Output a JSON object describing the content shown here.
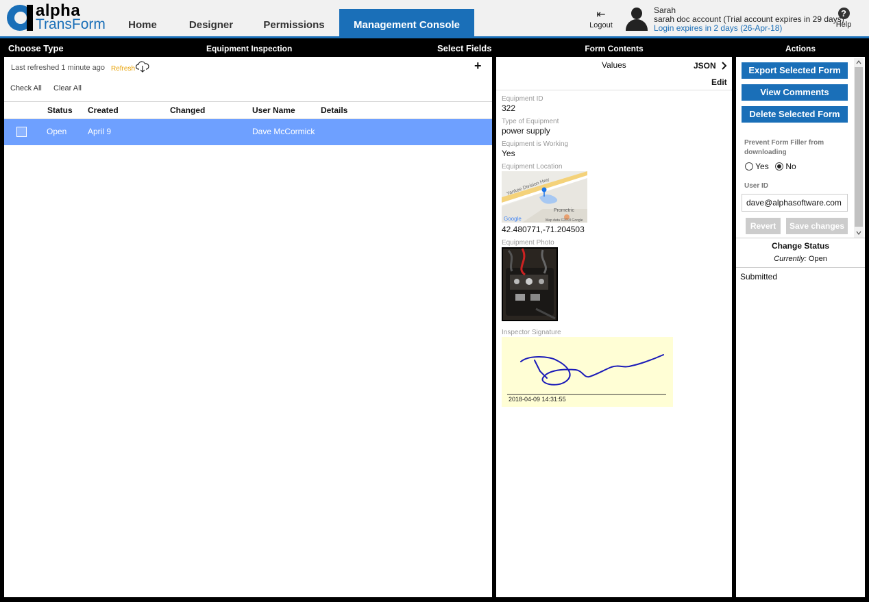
{
  "brand": {
    "alpha": "alpha",
    "transform": "TransForm"
  },
  "nav": {
    "home": "Home",
    "designer": "Designer",
    "permissions": "Permissions",
    "console": "Management Console"
  },
  "header": {
    "logout": "Logout",
    "user_name": "Sarah",
    "account": "sarah doc account (Trial account expires in 29 days)",
    "login_expire": "Login expires in 2 days (26-Apr-18)",
    "help": "Help"
  },
  "left": {
    "choose_type": "Choose Type",
    "form_title": "Equipment Inspection",
    "select_fields": "Select Fields",
    "last_refreshed": "Last refreshed 1 minute ago",
    "refresh": "Refresh",
    "add": "+",
    "check_all": "Check All",
    "clear_all": "Clear All",
    "columns": {
      "status": "Status",
      "created": "Created",
      "changed": "Changed",
      "user": "User Name",
      "details": "Details"
    },
    "rows": [
      {
        "status": "Open",
        "created": "April 9",
        "changed": "",
        "user": "Dave McCormick",
        "details": ""
      }
    ]
  },
  "form": {
    "heading": "Form Contents",
    "values": "Values",
    "json": "JSON",
    "edit": "Edit",
    "fields": [
      {
        "label": "Equipment ID",
        "value": "322"
      },
      {
        "label": "Type of Equipment",
        "value": "power supply"
      },
      {
        "label": "Equipment is Working",
        "value": "Yes"
      },
      {
        "label": "Equipment Location",
        "value": "42.480771,-71.204503"
      },
      {
        "label": "Equipment Photo",
        "value": ""
      },
      {
        "label": "Inspector Signature",
        "value": ""
      }
    ],
    "map": {
      "road": "Yankee Division Hwy",
      "place": "Prometric",
      "google": "Google",
      "credit": "Map data ©2018 Google"
    },
    "signature_date": "2018-04-09 14:31:55"
  },
  "actions": {
    "heading": "Actions",
    "export": "Export Selected Form",
    "view_comments": "View Comments",
    "delete": "Delete Selected Form",
    "prevent_label": "Prevent Form Filler from downloading",
    "yes": "Yes",
    "no": "No",
    "user_id_label": "User ID",
    "user_id_value": "dave@alphasoftware.com",
    "revert": "Revert",
    "save": "Save changes",
    "change_status": "Change Status",
    "currently_label": "Currently:",
    "currently_value": "Open",
    "status_option": "Submitted"
  }
}
